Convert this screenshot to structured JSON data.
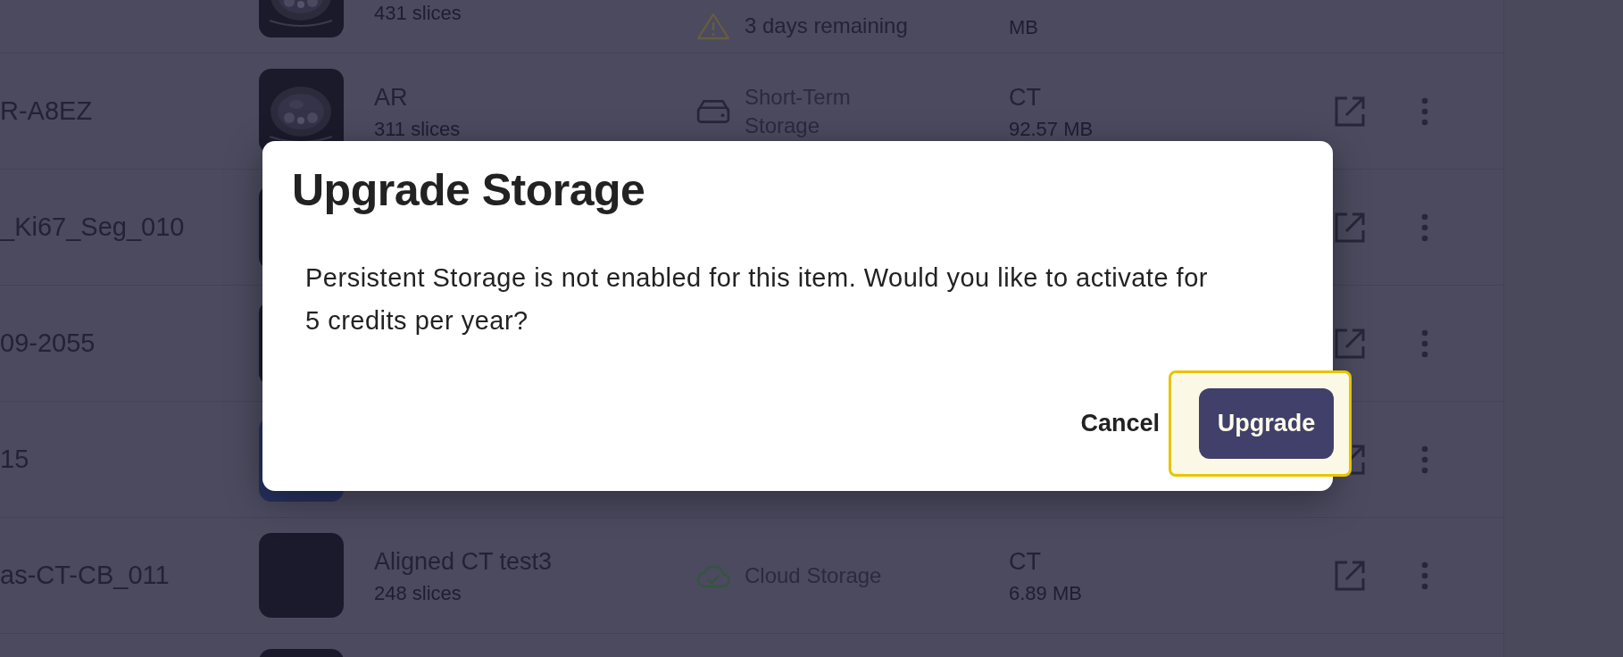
{
  "rows": [
    {
      "thumbnail": {
        "kind": "scan"
      },
      "slices": "431 slices",
      "warning": "3 days remaining",
      "size": "MB"
    },
    {
      "name": "R-A8EZ",
      "thumbnail": {
        "kind": "scan"
      },
      "title": "AR",
      "slices": "311 slices",
      "storage": {
        "kind": "drive",
        "label": "Short-Term Storage"
      },
      "type": "CT",
      "size": "92.57 MB"
    },
    {
      "name": "_Ki67_Seg_010",
      "thumbnail": {
        "kind": "plain"
      }
    },
    {
      "name": "09-2055",
      "thumbnail": {
        "kind": "plain"
      }
    },
    {
      "name": "15",
      "thumbnail": {
        "kind": "blue"
      }
    },
    {
      "name": "as-CT-CB_011",
      "thumbnail": {
        "kind": "plain"
      },
      "title": "Aligned CT test3",
      "slices": "248 slices",
      "storage": {
        "kind": "cloud",
        "label": "Cloud Storage"
      },
      "type": "CT",
      "size": "6.89 MB"
    },
    {
      "thumbnail": {
        "kind": "plain"
      }
    }
  ],
  "dialog": {
    "title": "Upgrade Storage",
    "message": "Persistent Storage is not enabled for this item. Would you like to activate for 5 credits per year?",
    "cancel": "Cancel",
    "confirm": "Upgrade",
    "confirm_highlighted": true
  }
}
